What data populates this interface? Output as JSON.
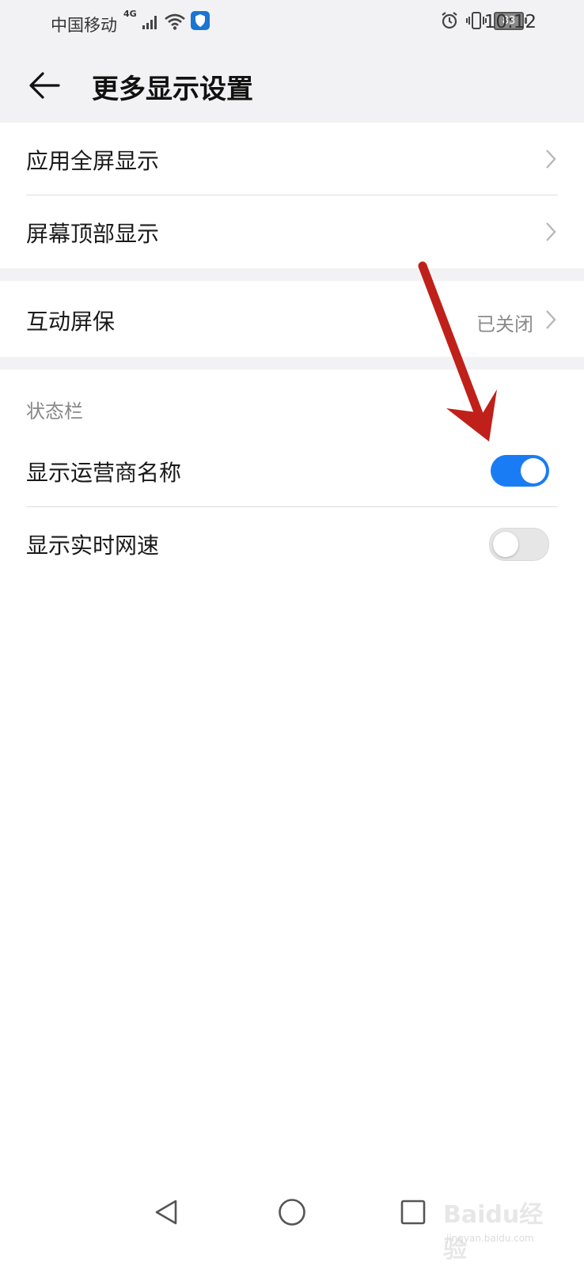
{
  "status_bar": {
    "carrier": "中国移动",
    "network": "4G",
    "battery": "83",
    "time": "10:12",
    "icons": [
      "signal-icon",
      "wifi-icon",
      "shield-app-icon",
      "alarm-icon",
      "vibrate-icon",
      "battery-icon"
    ]
  },
  "header": {
    "back_icon": "back-arrow-icon",
    "title": "更多显示设置"
  },
  "group1": {
    "items": [
      {
        "label": "应用全屏显示"
      },
      {
        "label": "屏幕顶部显示"
      }
    ]
  },
  "group2": {
    "item": {
      "label": "互动屏保",
      "value": "已关闭"
    }
  },
  "status_section": {
    "title": "状态栏",
    "items": [
      {
        "label": "显示运营商名称",
        "enabled": true
      },
      {
        "label": "显示实时网速",
        "enabled": false
      }
    ]
  },
  "colors": {
    "accent": "#1a7cf5",
    "annotation_arrow": "#c0201a",
    "header_bg": "#f2f2f4"
  },
  "nav_bar": {
    "icons": [
      "back-triangle-icon",
      "home-circle-icon",
      "recents-square-icon"
    ]
  },
  "watermark": {
    "main": "Baidu经验",
    "sub": "jingyan.baidu.com"
  }
}
